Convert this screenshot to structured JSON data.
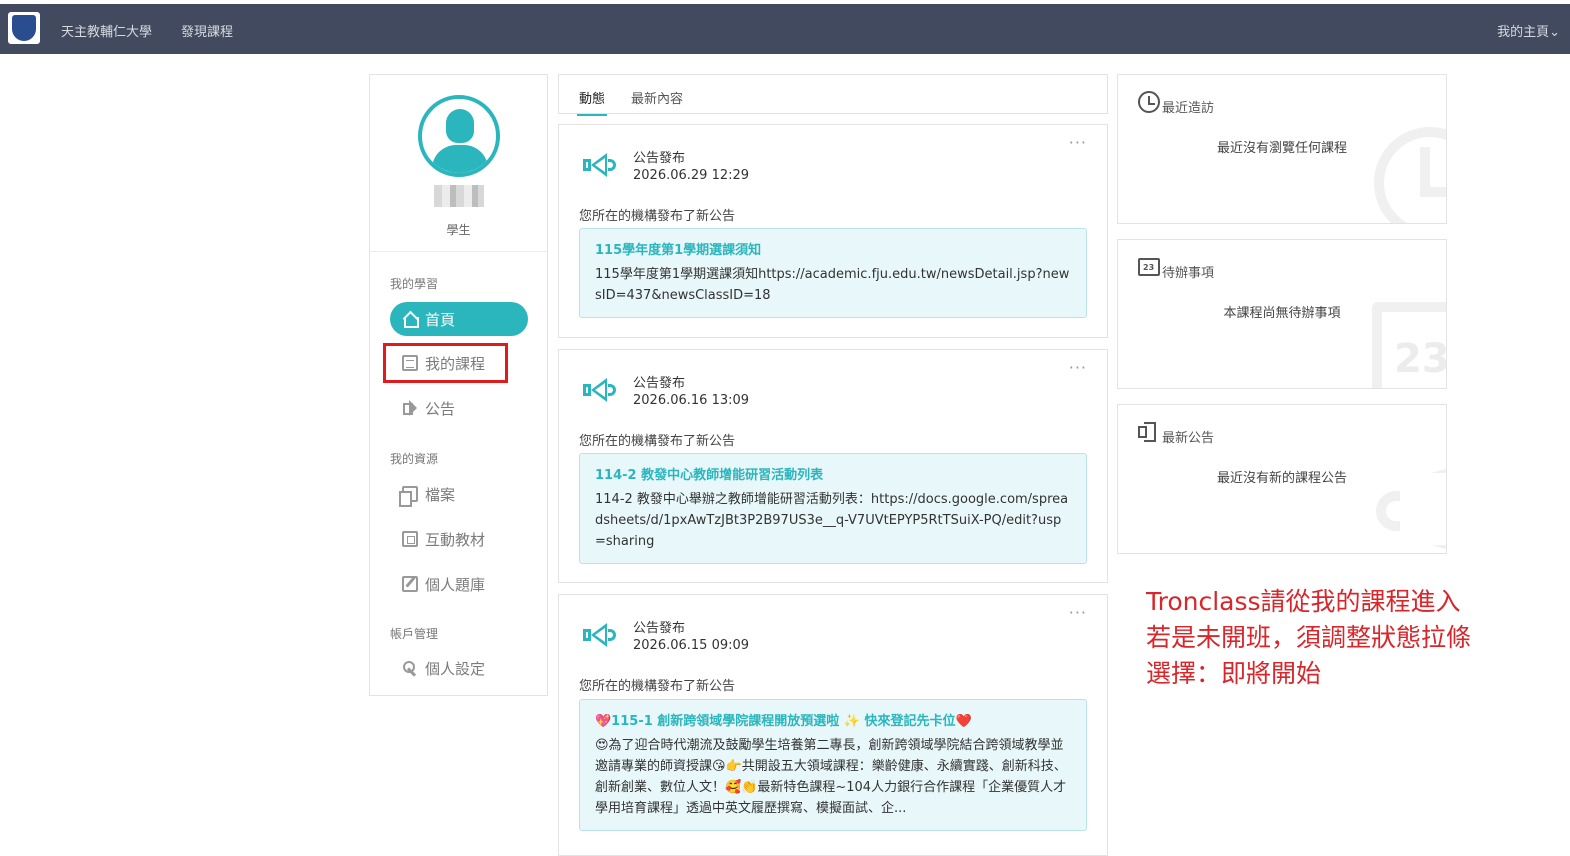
{
  "topbar": {
    "university": "天主教輔仁大學",
    "discover": "發現課程",
    "my_home": "我的主頁",
    "chevron": "⌄"
  },
  "profile": {
    "role": "學生"
  },
  "sidebar": {
    "sections": [
      {
        "title": "我的學習"
      },
      {
        "title": "我的資源"
      },
      {
        "title": "帳戶管理"
      }
    ],
    "items": [
      {
        "label": "首頁",
        "icon": "home-icon"
      },
      {
        "label": "我的課程",
        "icon": "document-icon"
      },
      {
        "label": "公告",
        "icon": "announcement-icon"
      },
      {
        "label": "檔案",
        "icon": "file-icon"
      },
      {
        "label": "互動教材",
        "icon": "interactive-material-icon"
      },
      {
        "label": "個人題庫",
        "icon": "question-bank-icon"
      },
      {
        "label": "個人設定",
        "icon": "settings-wrench-icon"
      }
    ]
  },
  "tabs": [
    {
      "label": "動態"
    },
    {
      "label": "最新內容"
    }
  ],
  "feed": [
    {
      "type": "公告發布",
      "date": "2026.06.29 12:29",
      "desc": "您所在的機構發布了新公告",
      "title": "115學年度第1學期選課須知",
      "body": "115學年度第1學期選課須知https://academic.fju.edu.tw/newsDetail.jsp?newsID=437&newsClassID=18",
      "more": "···"
    },
    {
      "type": "公告發布",
      "date": "2026.06.16 13:09",
      "desc": "您所在的機構發布了新公告",
      "title": "114-2 教發中心教師增能研習活動列表",
      "body": "114-2 教發中心舉辦之教師增能研習活動列表：https://docs.google.com/spreadsheets/d/1pxAwTzJBt3P2B97US3e__q-V7UVtEPYP5RtTSuiX-PQ/edit?usp=sharing",
      "more": "···"
    },
    {
      "type": "公告發布",
      "date": "2026.06.15 09:09",
      "desc": "您所在的機構發布了新公告",
      "title": "💖115-1 創新跨領域學院課程開放預選啦 ✨ 快來登記先卡位❤️",
      "body": "😍為了迎合時代潮流及鼓勵學生培養第二專長，創新跨領域學院結合跨領域教學並邀請專業的師資授課😘👉共開設五大領域課程：樂齡健康、永續實踐、創新科技、創新創業、數位人文！🥰👏最新特色課程~104人力銀行合作課程「企業優質人才學用培育課程」透過中英文履歷撰寫、模擬面試、企...",
      "more": "···"
    }
  ],
  "widgets": [
    {
      "title": "最近造訪",
      "message": "最近沒有瀏覽任何課程",
      "icon": "clock-icon"
    },
    {
      "title": "待辦事項",
      "message": "本課程尚無待辦事項",
      "icon": "calendar-icon",
      "bg_text": "23"
    },
    {
      "title": "最新公告",
      "message": "最近沒有新的課程公告",
      "icon": "speaker-icon"
    }
  ],
  "note": {
    "line1": "Tronclass請從我的課程進入",
    "line2": "若是未開班，須調整狀態拉條",
    "line3": "選擇：即將開始"
  },
  "colors": {
    "topbar": "#414a5e",
    "accent": "#2bb6be",
    "highlight": "#e01b1b",
    "note": "#d8262a"
  }
}
